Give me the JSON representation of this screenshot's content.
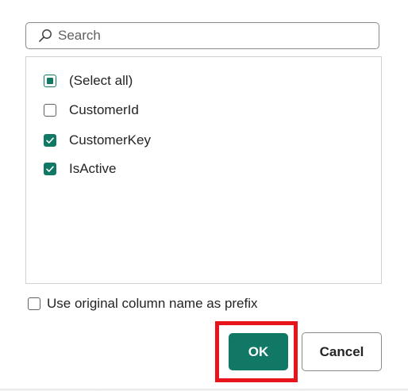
{
  "search": {
    "placeholder": "Search",
    "value": ""
  },
  "columns": {
    "items": [
      {
        "label": "(Select all)",
        "state": "mixed"
      },
      {
        "label": "CustomerId",
        "state": "unchecked"
      },
      {
        "label": "CustomerKey",
        "state": "checked"
      },
      {
        "label": "IsActive",
        "state": "checked"
      }
    ]
  },
  "options": {
    "prefix_label": "Use original column name as prefix",
    "prefix_checked": false
  },
  "buttons": {
    "ok_label": "OK",
    "cancel_label": "Cancel"
  },
  "colors": {
    "accent": "#117865",
    "highlight": "#e8141c"
  },
  "icons": {
    "search": "search-icon"
  }
}
